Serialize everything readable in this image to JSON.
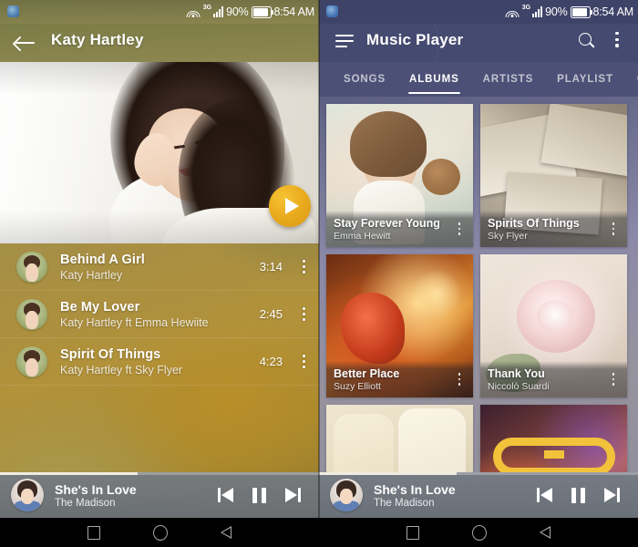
{
  "status_bar": {
    "notification_icon": "notification-icon",
    "wifi_icon": "wifi-icon",
    "network_type": "3G",
    "signal_icon": "signal-bars-icon",
    "battery_percent": "90%",
    "battery_icon": "battery-icon",
    "time": "8:54 AM"
  },
  "left_panel": {
    "back_icon": "back-arrow-icon",
    "title": "Katy Hartley",
    "play_button_label": "play-icon",
    "songs": [
      {
        "title": "Behind A Girl",
        "artist": "Katy Hartley",
        "duration": "3:14",
        "menu": "overflow-icon"
      },
      {
        "title": "Be My Lover",
        "artist": "Katy Hartley ft Emma Hewiite",
        "duration": "2:45",
        "menu": "overflow-icon"
      },
      {
        "title": "Spirit Of Things",
        "artist": "Katy Hartley ft Sky Flyer",
        "duration": "4:23",
        "menu": "overflow-icon"
      }
    ]
  },
  "right_panel": {
    "menu_icon": "hamburger-icon",
    "title": "Music Player",
    "search_icon": "search-icon",
    "overflow_icon": "overflow-icon",
    "tabs": [
      {
        "label": "SONGS",
        "active": false
      },
      {
        "label": "ALBUMS",
        "active": true
      },
      {
        "label": "ARTISTS",
        "active": false
      },
      {
        "label": "PLAYLIST",
        "active": false
      },
      {
        "label": "GEN",
        "active": false
      }
    ],
    "albums": [
      {
        "title": "Stay Forever Young",
        "artist": "Emma Hewitt",
        "menu": "overflow-icon"
      },
      {
        "title": "Spirits Of Things",
        "artist": "Sky Flyer",
        "menu": "overflow-icon"
      },
      {
        "title": "Better Place",
        "artist": "Suzy Elliott",
        "menu": "overflow-icon"
      },
      {
        "title": "Thank You",
        "artist": "Niccolò Suardi",
        "menu": "overflow-icon"
      },
      {
        "title": "",
        "artist": "",
        "menu": "overflow-icon"
      },
      {
        "title": "",
        "artist": "",
        "menu": "overflow-icon"
      }
    ]
  },
  "mini_player": {
    "title": "She's In Love",
    "artist": "The Madison",
    "progress_percent": 43,
    "prev_icon": "skip-previous-icon",
    "pause_icon": "pause-icon",
    "next_icon": "skip-next-icon"
  },
  "nav_bar": {
    "recents_icon": "recents-square-icon",
    "home_icon": "home-circle-icon",
    "back_icon": "back-triangle-icon"
  },
  "colors": {
    "accent_orange": "#e8a81b",
    "right_appbar": "#454a70",
    "right_tabbar": "#4c5076",
    "mini_player": "#747a82"
  }
}
